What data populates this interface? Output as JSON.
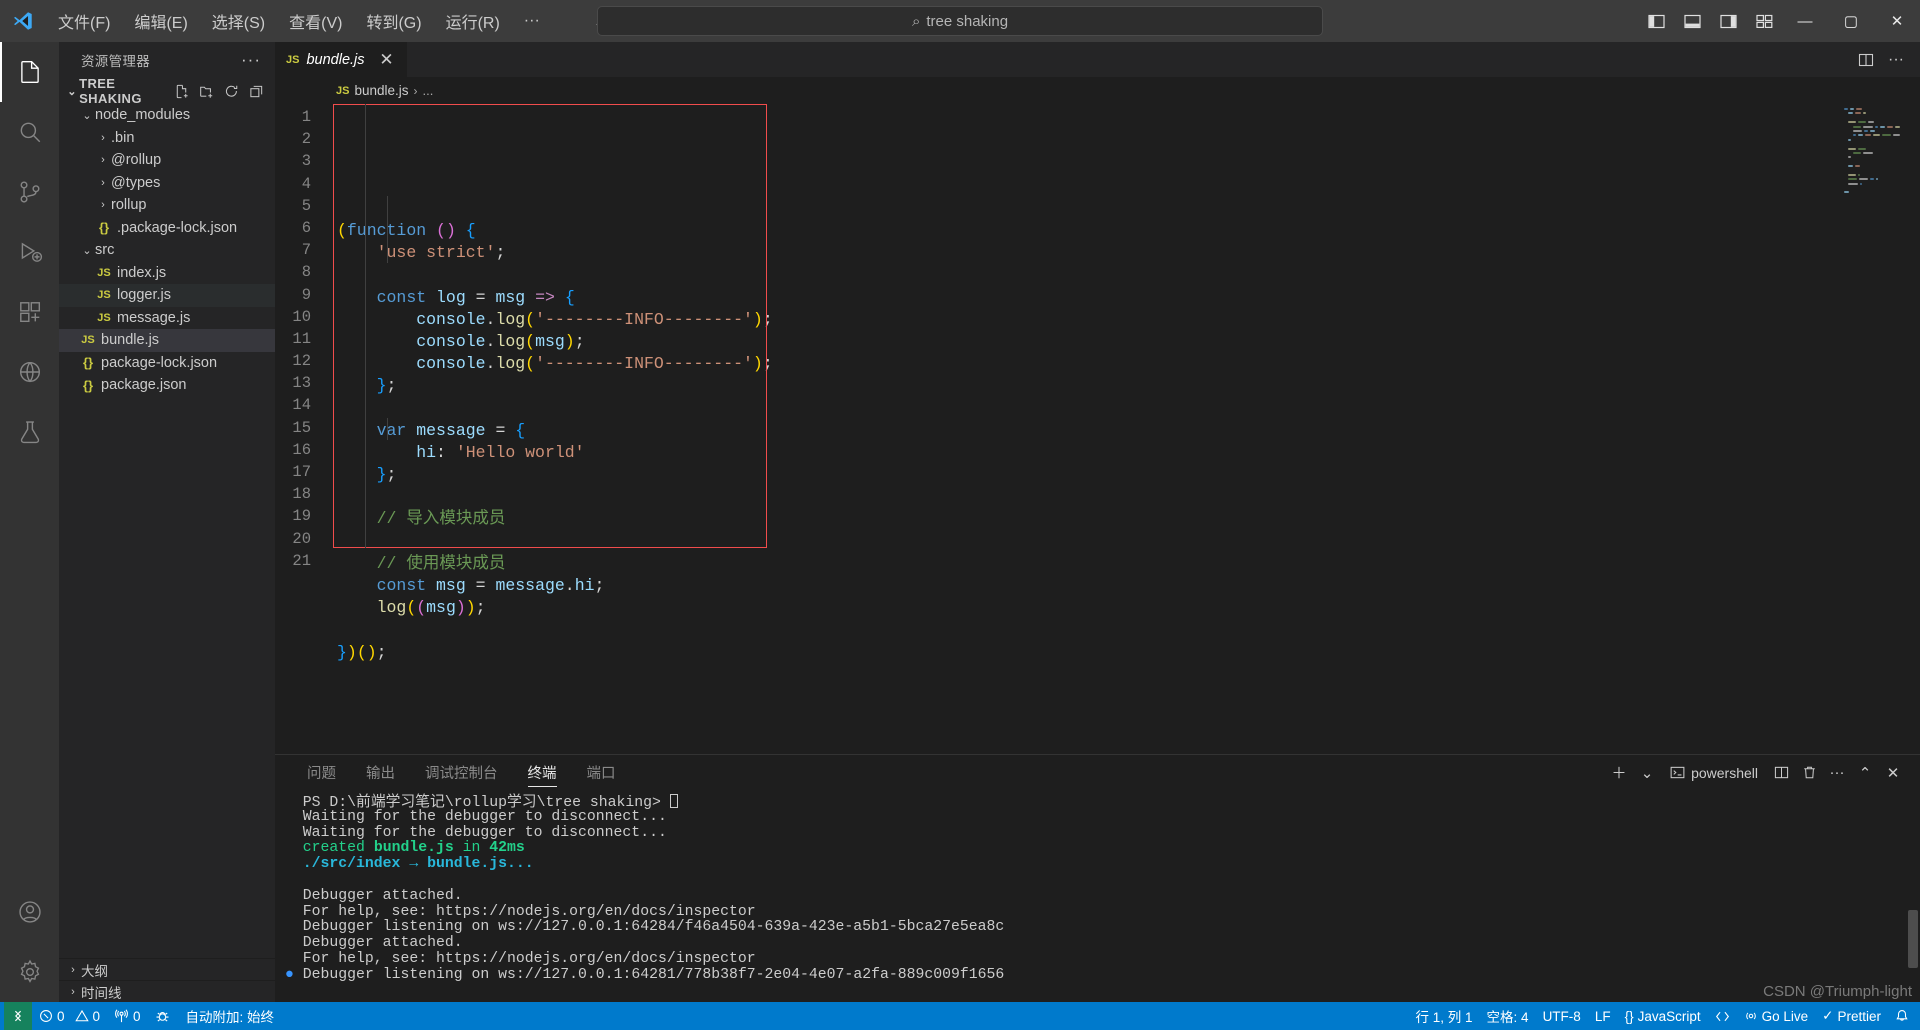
{
  "titlebar": {
    "logo_icon": "vscode-logo-icon",
    "menus": [
      {
        "label": "文件(F)",
        "name": "menu-file"
      },
      {
        "label": "编辑(E)",
        "name": "menu-edit"
      },
      {
        "label": "选择(S)",
        "name": "menu-selection"
      },
      {
        "label": "查看(V)",
        "name": "menu-view"
      },
      {
        "label": "转到(G)",
        "name": "menu-go"
      },
      {
        "label": "运行(R)",
        "name": "menu-run"
      },
      {
        "label": "···",
        "name": "menu-more"
      }
    ],
    "nav_back_icon": "arrow-left-icon",
    "nav_forward_icon": "arrow-right-icon",
    "search": {
      "value": "tree shaking",
      "icon": "search-icon"
    },
    "layout_buttons": [
      {
        "name": "toggle-primary-sidebar-icon"
      },
      {
        "name": "toggle-panel-icon"
      },
      {
        "name": "toggle-secondary-sidebar-icon"
      },
      {
        "name": "customize-layout-icon"
      }
    ],
    "window_controls": {
      "minimize": "—",
      "maximize": "▢",
      "close": "✕"
    }
  },
  "activitybar": {
    "items": [
      {
        "name": "activity-explorer",
        "icon": "files-icon",
        "active": true
      },
      {
        "name": "activity-search",
        "icon": "search-icon",
        "active": false
      },
      {
        "name": "activity-source-control",
        "icon": "source-control-icon",
        "active": false
      },
      {
        "name": "activity-run-debug",
        "icon": "run-and-debug-icon",
        "active": false
      },
      {
        "name": "activity-extensions",
        "icon": "extensions-icon",
        "active": false
      },
      {
        "name": "activity-remote",
        "icon": "remote-explorer-icon",
        "active": false
      },
      {
        "name": "activity-testing",
        "icon": "testing-beaker-icon",
        "active": false
      }
    ],
    "bottom_items": [
      {
        "name": "activity-accounts",
        "icon": "account-icon"
      },
      {
        "name": "activity-settings",
        "icon": "gear-icon"
      }
    ]
  },
  "sidebar": {
    "title": "资源管理器",
    "more_actions_icon": "ellipsis-icon",
    "section": {
      "label": "TREE SHAKING",
      "expanded": true,
      "actions": [
        {
          "name": "new-file-icon"
        },
        {
          "name": "new-folder-icon"
        },
        {
          "name": "refresh-explorer-icon"
        },
        {
          "name": "collapse-folders-icon"
        }
      ]
    },
    "tree": [
      {
        "label": "node_modules",
        "type": "folder",
        "expanded": true,
        "indent": 1,
        "state": "none"
      },
      {
        "label": ".bin",
        "type": "folder",
        "expanded": false,
        "indent": 2,
        "state": "none"
      },
      {
        "label": "@rollup",
        "type": "folder",
        "expanded": false,
        "indent": 2,
        "state": "none"
      },
      {
        "label": "@types",
        "type": "folder",
        "expanded": false,
        "indent": 2,
        "state": "none"
      },
      {
        "label": "rollup",
        "type": "folder",
        "expanded": false,
        "indent": 2,
        "state": "none"
      },
      {
        "label": ".package-lock.json",
        "type": "json",
        "expanded": false,
        "indent": 2,
        "state": "none"
      },
      {
        "label": "src",
        "type": "folder",
        "expanded": true,
        "indent": 1,
        "state": "none"
      },
      {
        "label": "index.js",
        "type": "js",
        "expanded": false,
        "indent": 2,
        "state": "none"
      },
      {
        "label": "logger.js",
        "type": "js",
        "expanded": false,
        "indent": 2,
        "state": "hovered"
      },
      {
        "label": "message.js",
        "type": "js",
        "expanded": false,
        "indent": 2,
        "state": "none"
      },
      {
        "label": "bundle.js",
        "type": "js",
        "expanded": false,
        "indent": 1,
        "state": "selected"
      },
      {
        "label": "package-lock.json",
        "type": "json",
        "expanded": false,
        "indent": 1,
        "state": "none"
      },
      {
        "label": "package.json",
        "type": "json",
        "expanded": false,
        "indent": 1,
        "state": "none"
      }
    ],
    "collapsed_sections": [
      {
        "label": "大纲",
        "name": "outline-section"
      },
      {
        "label": "时间线",
        "name": "timeline-section"
      }
    ]
  },
  "editor": {
    "tab": {
      "icon": "js-file-icon",
      "name": "bundle.js",
      "close_icon": "close-icon"
    },
    "tab_actions": [
      {
        "name": "split-editor-icon"
      },
      {
        "name": "editor-more-actions-icon"
      }
    ],
    "breadcrumb": {
      "file_icon": "js-file-icon",
      "file": "bundle.js",
      "separator": "›",
      "more": "..."
    },
    "line_numbers": [
      "1",
      "2",
      "3",
      "4",
      "5",
      "6",
      "7",
      "8",
      "9",
      "10",
      "11",
      "12",
      "13",
      "14",
      "15",
      "16",
      "17",
      "18",
      "19",
      "20",
      "21"
    ],
    "code_lines": [
      "(function () {",
      "    'use strict';",
      "",
      "    const log = msg => {",
      "        console.log('--------INFO--------');",
      "        console.log(msg);",
      "        console.log('--------INFO--------');",
      "    };",
      "",
      "    var message = {",
      "        hi: 'Hello world'",
      "    };",
      "",
      "    // 导入模块成员",
      "",
      "    // 使用模块成员",
      "    const msg = message.hi;",
      "    log((msg));",
      "",
      "})();",
      ""
    ],
    "highlight_box_color": "#f14c4c"
  },
  "panel": {
    "tabs": [
      {
        "label": "问题",
        "name": "panel-tab-problems",
        "active": false
      },
      {
        "label": "输出",
        "name": "panel-tab-output",
        "active": false
      },
      {
        "label": "调试控制台",
        "name": "panel-tab-debug-console",
        "active": false
      },
      {
        "label": "终端",
        "name": "panel-tab-terminal",
        "active": true
      },
      {
        "label": "端口",
        "name": "panel-tab-ports",
        "active": false
      }
    ],
    "actions": {
      "new_terminal_icon": "plus-icon",
      "dropdown_icon": "chevron-down-icon",
      "shell_label": "powershell",
      "shell_icon": "terminal-icon",
      "split_icon": "split-terminal-icon",
      "kill_icon": "trash-icon",
      "more_icon": "ellipsis-icon",
      "maximize_icon": "chevron-up-icon",
      "close_icon": "close-icon"
    },
    "terminal_lines": [
      {
        "text": "Debugger listening on ws://127.0.0.1:64281/778b38f7-2e04-4e07-a2fa-889c009f1656",
        "style": "white",
        "bullet": true
      },
      {
        "text": "For help, see: https://nodejs.org/en/docs/inspector",
        "style": "white",
        "bullet": false
      },
      {
        "text": "Debugger attached.",
        "style": "white",
        "bullet": false
      },
      {
        "text": "Debugger listening on ws://127.0.0.1:64284/f46a4504-639a-423e-a5b1-5bca27e5ea8c",
        "style": "white",
        "bullet": false
      },
      {
        "text": "For help, see: https://nodejs.org/en/docs/inspector",
        "style": "white",
        "bullet": false
      },
      {
        "text": "Debugger attached.",
        "style": "white",
        "bullet": false
      },
      {
        "text": "",
        "style": "white",
        "bullet": false
      },
      {
        "text": "./src/index → bundle.js...",
        "style": "cyan",
        "bullet": false
      },
      {
        "text": "created bundle.js in 42ms",
        "style": "green",
        "bullet": false
      },
      {
        "text": "Waiting for the debugger to disconnect...",
        "style": "white",
        "bullet": false
      },
      {
        "text": "Waiting for the debugger to disconnect...",
        "style": "white",
        "bullet": false
      },
      {
        "text": "PS D:\\前端学习笔记\\rollup学习\\tree shaking>",
        "style": "white",
        "bullet": false
      }
    ]
  },
  "statusbar": {
    "remote_icon": "remote-indicator-icon",
    "errors_icon": "error-icon",
    "errors": "0",
    "warnings_icon": "warning-icon",
    "warnings": "0",
    "radio_icon": "radio-tower-icon",
    "radio_count": "0",
    "debug_icon": "debug-alt-icon",
    "auto_attach": "自动附加: 始终",
    "right_items": [
      {
        "label": "行 1, 列 1",
        "name": "status-cursor-position"
      },
      {
        "label": "空格: 4",
        "name": "status-indentation"
      },
      {
        "label": "UTF-8",
        "name": "status-encoding"
      },
      {
        "label": "LF",
        "name": "status-eol"
      },
      {
        "label": "JavaScript",
        "name": "status-language-mode"
      },
      {
        "label": "Go Live",
        "name": "status-go-live"
      },
      {
        "label": "Prettier",
        "name": "status-prettier"
      }
    ],
    "prettier_icon": "checkmark-icon",
    "golive_icon": "broadcast-icon",
    "bell_icon": "bell-icon",
    "json_icon": "json-braces-icon"
  },
  "watermark": "CSDN @Triumph-light"
}
